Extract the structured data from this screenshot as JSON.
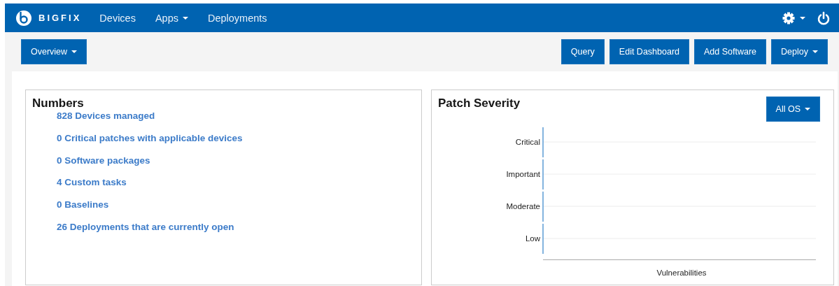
{
  "nav": {
    "brand": "BIGFIX",
    "items": [
      {
        "label": "Devices",
        "dropdown": false
      },
      {
        "label": "Apps",
        "dropdown": true
      },
      {
        "label": "Deployments",
        "dropdown": false
      }
    ]
  },
  "toolbar": {
    "left": [
      {
        "label": "Overview",
        "dropdown": true
      }
    ],
    "right": [
      {
        "label": "Query",
        "dropdown": false
      },
      {
        "label": "Edit Dashboard",
        "dropdown": false
      },
      {
        "label": "Add Software",
        "dropdown": false
      },
      {
        "label": "Deploy",
        "dropdown": true
      }
    ]
  },
  "numbers": {
    "title": "Numbers",
    "links": [
      "828 Devices managed",
      "0 Critical patches with applicable devices",
      "0 Software packages",
      "4 Custom tasks",
      "0 Baselines",
      "26 Deployments that are currently open"
    ]
  },
  "patch_severity": {
    "title": "Patch Severity",
    "filter": {
      "label": "All OS",
      "dropdown": true
    },
    "chart": {
      "categories": [
        "Critical",
        "Important",
        "Moderate",
        "Low"
      ],
      "axis_title": "Vulnerabilities"
    }
  }
}
